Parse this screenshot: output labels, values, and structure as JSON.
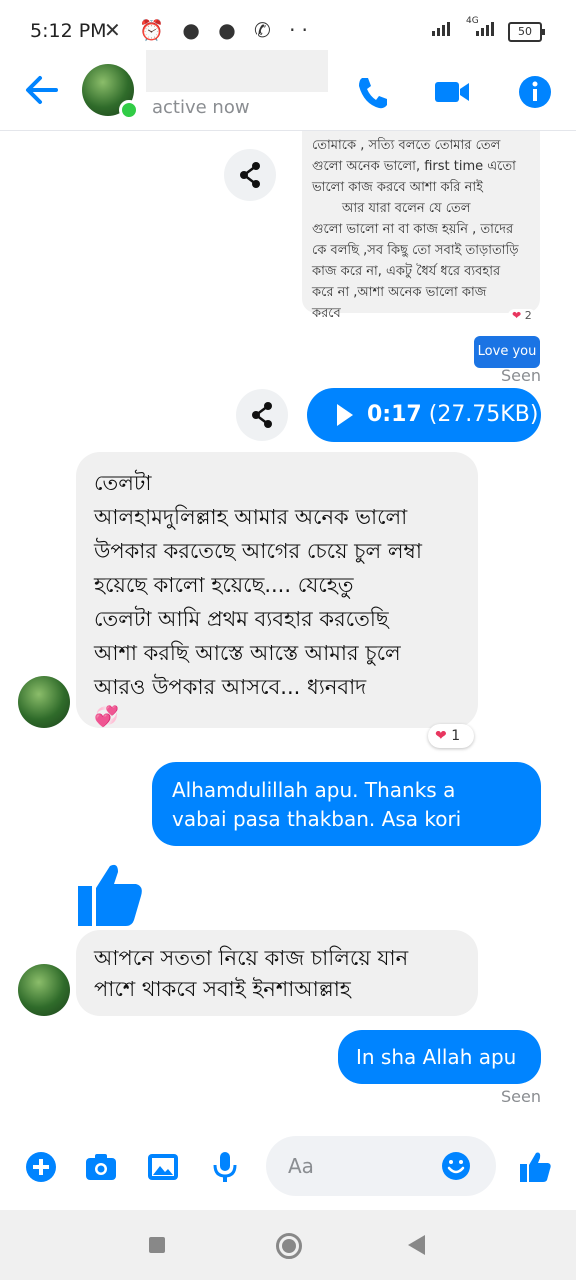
{
  "status_bar": {
    "time": "5:12 PM",
    "icons": [
      "mute-icon",
      "alarm-icon",
      "messenger-icon",
      "facebook-icon",
      "call-icon"
    ],
    "network": "4G",
    "battery": "50"
  },
  "header": {
    "status": "active now",
    "icons": [
      "back-arrow-icon",
      "phone-icon",
      "video-icon",
      "info-icon"
    ],
    "accent": "#0084ff"
  },
  "messages": {
    "image_text_lines": [
      "তোমাকে , সত্যি বলতে তোমার তেল",
      "গুলো অনেক ভালো, first time এতো",
      "ভালো কাজ করবে আশা করি নাই",
      "আর যারা বলেন যে তেল",
      "গুলো ভালো না বা কাজ হয়নি , তাদের",
      "কে বলছি ,সব কিছু তো সবাই তাড়াতাড়ি",
      "কাজ করে না, একটু ধৈর্য ধরে ব্যবহার",
      "করে না ,আশা অনেক ভালো কাজ",
      "করবে"
    ],
    "image_reaction": "2",
    "love_you": "Love you",
    "seen_1": "Seen",
    "audio_duration": "0:17",
    "audio_size": "(27.75KB)",
    "incoming_1": "তেলটা\nআলহামদুলিল্লাহ আমার অনেক ভালো\nউপকার করতেছে আগের চেয়ে চুল লম্বা\nহয়েছে কালো হয়েছে.... যেহেতু\n তেলটা আমি প্রথম ব্যবহার করতেছি\nআশা করছি আস্তে আস্তে আমার চুলে\nআরও উপকার আসবে... ধ্যনবাদ",
    "incoming_1_emoji": "💞",
    "incoming_1_reaction": "1",
    "outgoing_1": "Alhamdulillah apu. Thanks a\nvabai pasa thakban. Asa kori",
    "incoming_2": "আপনে সততা নিয়ে কাজ চালিয়ে যান\nপাশে থাকবে সবাই ইনশাআল্লাহ",
    "outgoing_2": "In sha Allah apu",
    "seen_2": "Seen"
  },
  "composer": {
    "placeholder": "Aa",
    "icons": [
      "plus-icon",
      "camera-icon",
      "gallery-icon",
      "mic-icon",
      "emoji-icon",
      "like-icon"
    ]
  },
  "navbar": {
    "icons": [
      "recents-icon",
      "home-icon",
      "back-icon"
    ]
  }
}
